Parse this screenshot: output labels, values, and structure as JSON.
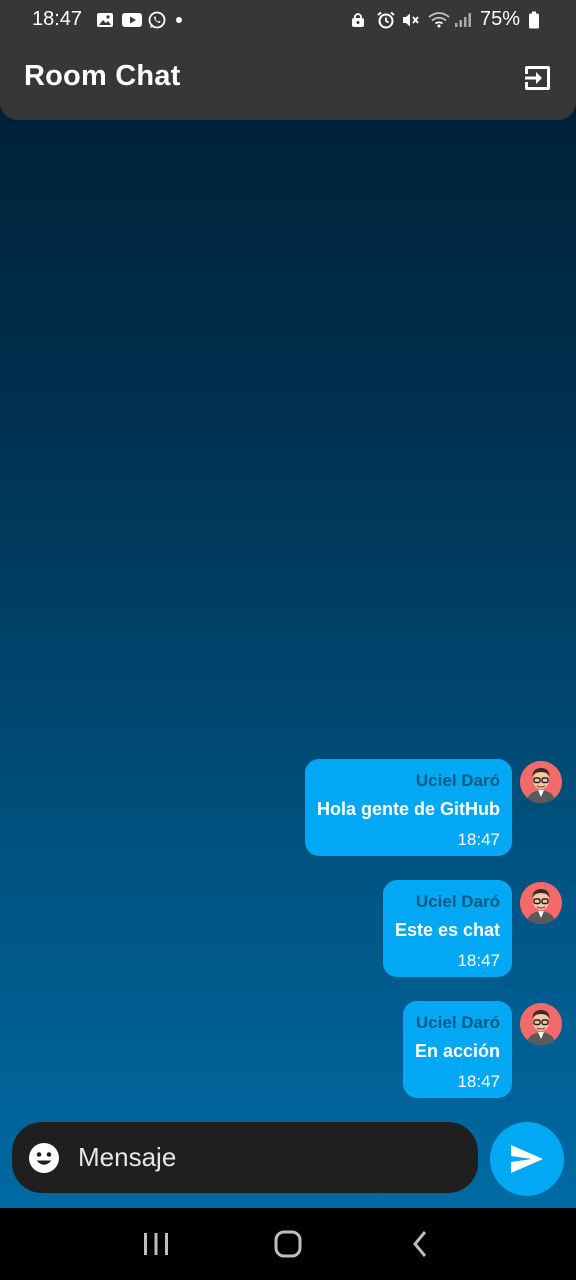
{
  "status_bar": {
    "time": "18:47",
    "left_icons": [
      "gallery-icon",
      "youtube-icon",
      "whatsapp-icon",
      "dot-icon"
    ],
    "right_icons": [
      "lock-icon",
      "alarm-icon",
      "mute-icon",
      "wifi-icon",
      "signal-icon"
    ],
    "battery_percent": "75%"
  },
  "app_bar": {
    "title": "Room Chat",
    "logout_icon": "logout-icon"
  },
  "messages": [
    {
      "author": "Uciel Daró",
      "text": "Hola gente de GitHub",
      "time": "18:47"
    },
    {
      "author": "Uciel Daró",
      "text": "Este es chat",
      "time": "18:47"
    },
    {
      "author": "Uciel Daró",
      "text": "En acción",
      "time": "18:47"
    }
  ],
  "composer": {
    "placeholder": "Mensaje",
    "emoji_icon": "emoji-icon",
    "send_icon": "send-icon"
  },
  "colors": {
    "bubble": "#02a8f4",
    "author": "#0c5a86",
    "app_bar": "#373737",
    "input": "#1f1f1f"
  },
  "nav_bar": [
    "recents-icon",
    "home-icon",
    "back-icon"
  ]
}
